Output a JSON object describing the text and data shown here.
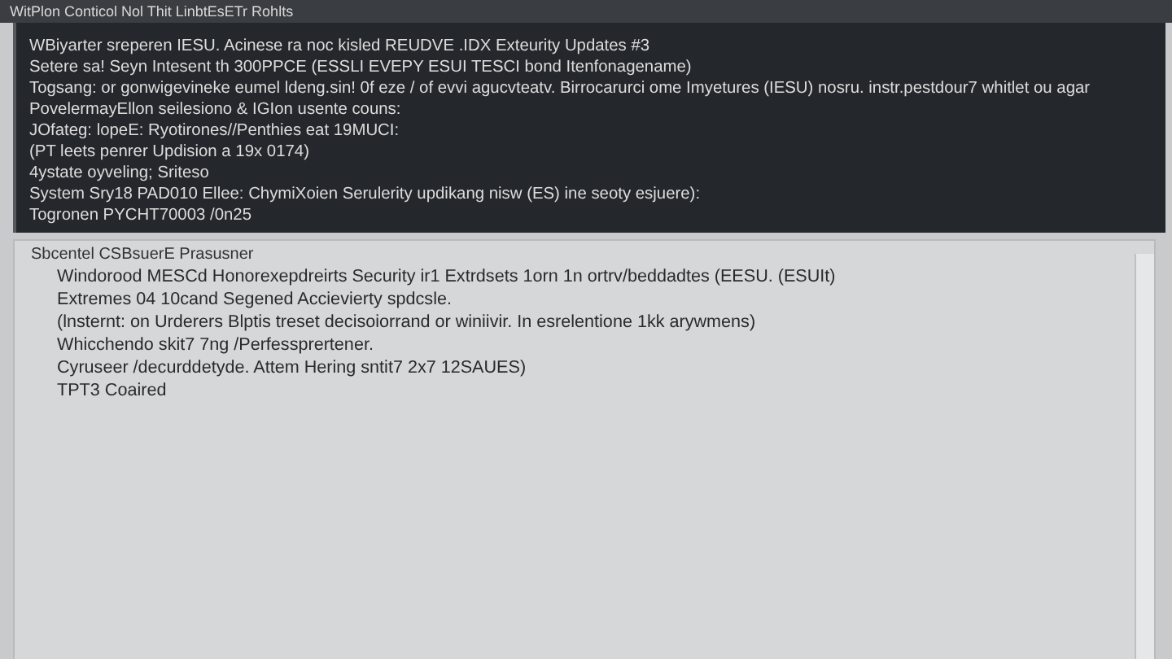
{
  "window": {
    "title": "WitPlon Conticol   Nol Thit LinbtEsETr Rohlts"
  },
  "terminal": {
    "lines": [
      "WBiyarter sreperen  IESU. Acinese ra noc kisled  REUDVE .IDX Exteurity Updates #3",
      "Setere sa! Seyn Intesent th 300PPCE (ESSLI EVEPY ESUI TESCI bond Itenfonagename)",
      "Togsang: or gonwigevineke eumel ldeng.sin! 0f eze / of evvi agucvteatv. Birrocarurci ome Imyetures (IESU) nosru. instr.pestdour7 whitlet ou agar",
      "PovelermayEllon seilesiono & IGIon usente couns:",
      "JOfateg: lopeE: Ryotirones//Penthies eat 19MUCI:",
      "(PT leets penrer Updision a 19x 0174)",
      "4ystate oyveling; Sriteso",
      "System Sry18 PAD010 Ellee: ChymiXoien Serulerity updikang nisw (ES) ine seoty esjuere):",
      "Togronen  PYCHT70003 /0n25"
    ]
  },
  "panel": {
    "heading": "Sbcentel CSBsuerE Prasusner",
    "lines": [
      "Windorood MESCd Honorexepdreirts Security ir1 Extrdsets 1orn 1n ortrv/beddadtes (EESU. (ESUIt)",
      "Extremes 04 10cand Segened Accievierty spdcsle.",
      "(lnsternt: on Urderers Blptis treset decisoiorrand or winiivir. In esrelentione 1kk arywmens)",
      "Whicchendo skit7 7ng /Perfessprertener.",
      "Cyruseer /decurddetyde. Attem Hering sntit7 2x7 12SAUES)",
      "TPT3 Coaired"
    ]
  }
}
